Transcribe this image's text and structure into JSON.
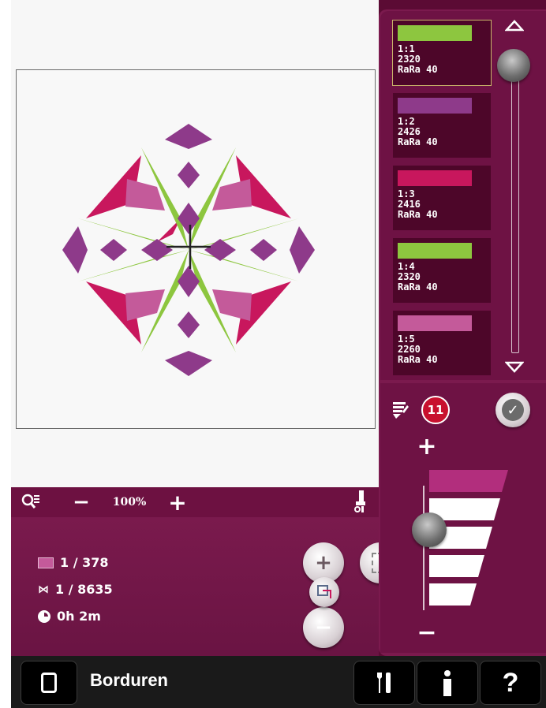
{
  "zoom": {
    "level": "100%",
    "minus": "−",
    "plus": "+"
  },
  "threads": [
    {
      "label": "1:1\n2320\nRaRa 40",
      "color": "#8dc63f"
    },
    {
      "label": "1:2\n2426\nRaRa 40",
      "color": "#8e3a8a"
    },
    {
      "label": "1:3\n2416\nRaRa 40",
      "color": "#c8175d"
    },
    {
      "label": "1:4\n2320\nRaRa 40",
      "color": "#8dc63f"
    },
    {
      "label": "1:5\n2260\nRaRa 40",
      "color": "#c45a9a"
    }
  ],
  "tension": {
    "badge": "11",
    "plus": "+",
    "minus": "−",
    "level_fraction": 0.6
  },
  "info": {
    "blocks": "1 / 378",
    "stitches": "1 / 8635",
    "time": "0h 2m"
  },
  "bottom": {
    "mode_label": "Borduren"
  },
  "colors": {
    "frame": "#5b0b34",
    "accent": "#c8175d"
  }
}
